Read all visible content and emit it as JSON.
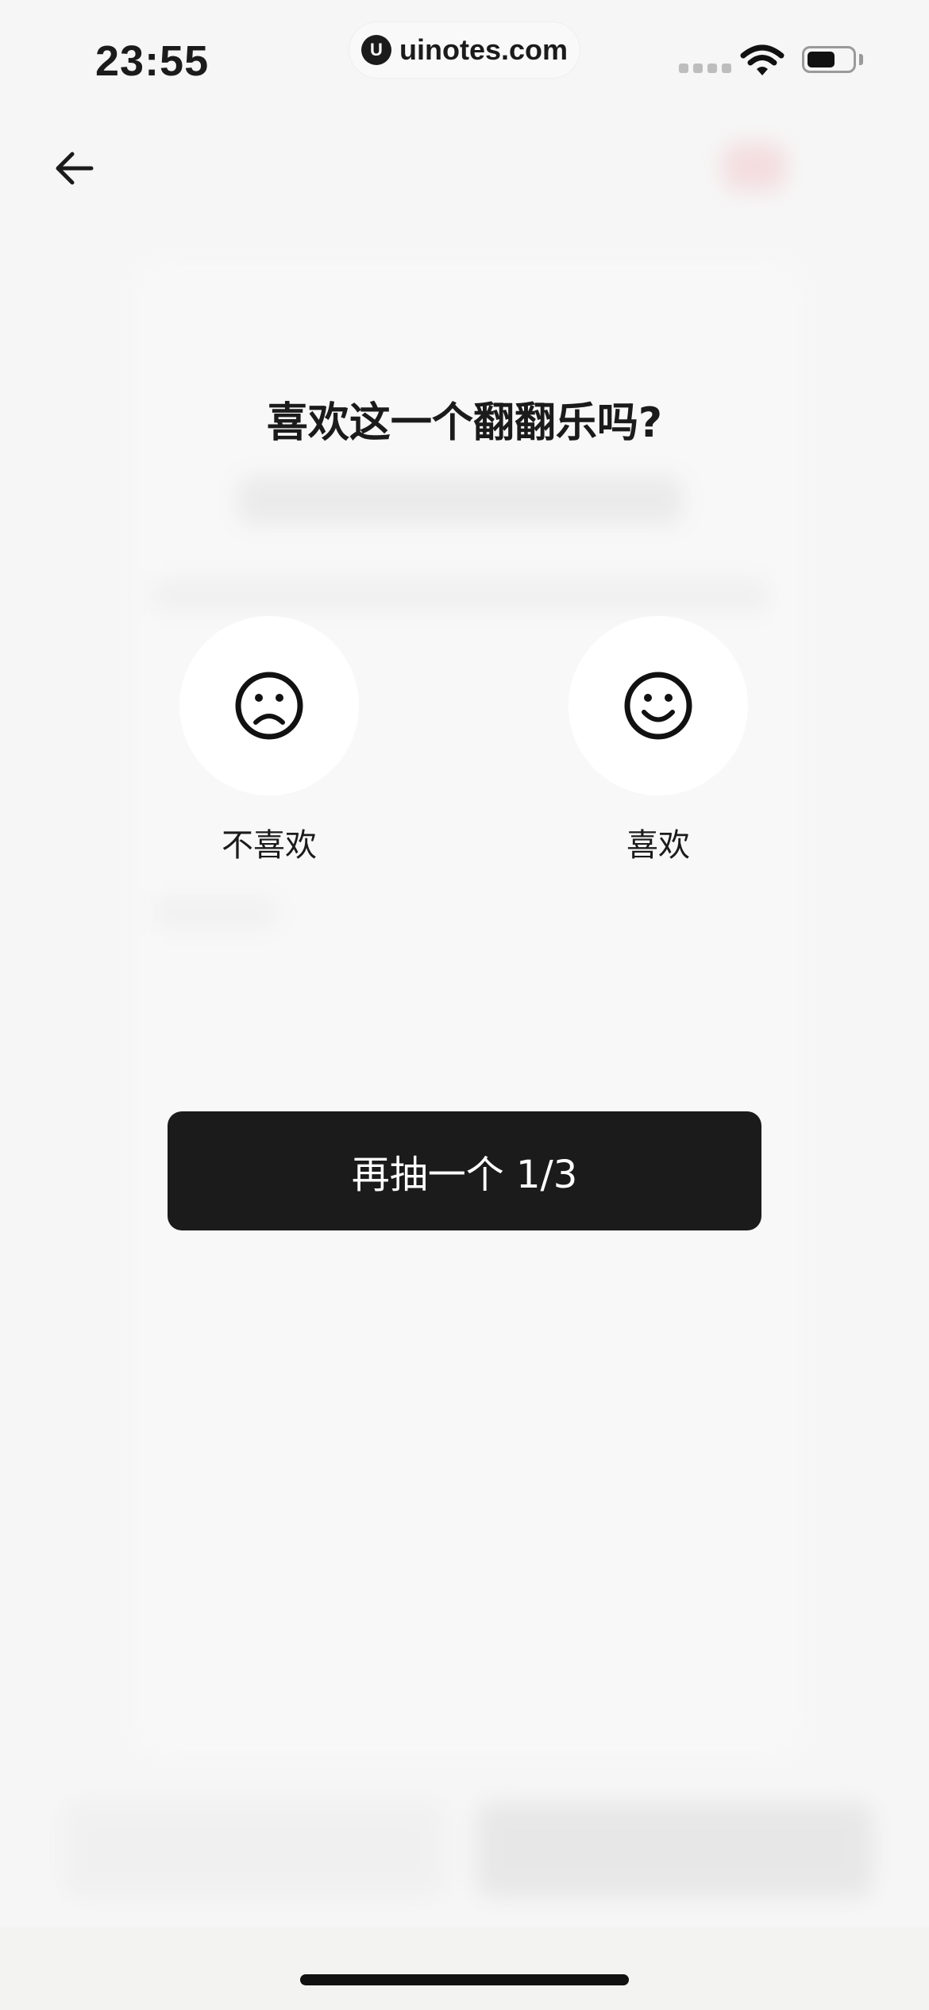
{
  "status_bar": {
    "time": "23:55",
    "url": "uinotes.com",
    "url_logo_letter": "U"
  },
  "modal": {
    "question": "喜欢这一个翻翻乐吗?",
    "dislike_label": "不喜欢",
    "like_label": "喜欢",
    "draw_again_label": "再抽一个 1/3"
  },
  "icons": {
    "back": "arrow-left-icon",
    "dislike": "frown-face-icon",
    "like": "smile-face-icon"
  },
  "colors": {
    "background": "#f6f6f6",
    "primary_button": "#1b1b1b",
    "text": "#1b1b1b",
    "circle": "#ffffff"
  }
}
